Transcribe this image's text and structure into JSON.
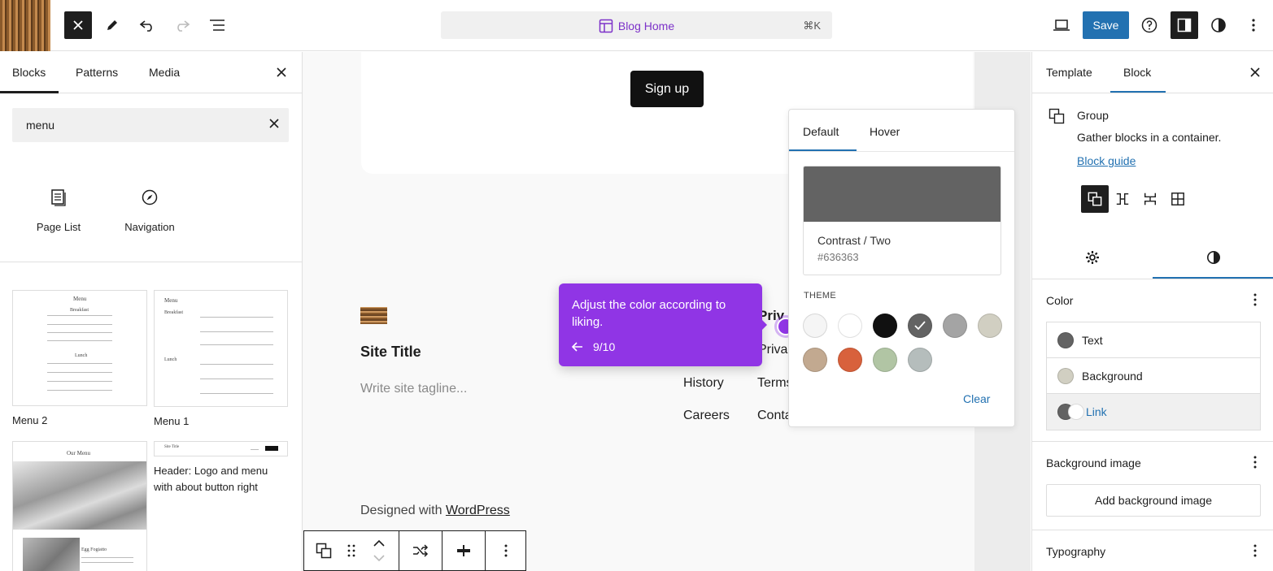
{
  "topbar": {
    "title": "Blog Home",
    "shortcut": "⌘K",
    "save_label": "Save"
  },
  "inserter": {
    "tabs": [
      "Blocks",
      "Patterns",
      "Media"
    ],
    "search_value": "menu",
    "blocks": [
      {
        "label": "Page List",
        "icon": "page-list-icon"
      },
      {
        "label": "Navigation",
        "icon": "compass-icon"
      }
    ],
    "patterns": [
      {
        "label": "Menu 2"
      },
      {
        "label": "Menu 1"
      },
      {
        "label": "Header: Logo and menu with about button right"
      }
    ],
    "mini": {
      "menu": "Menu",
      "breakfast": "Breakfast",
      "lunch": "Lunch",
      "our_menu": "Our Menu",
      "site_title": "Site Title",
      "egg": "Egg Fogiatto"
    }
  },
  "canvas": {
    "signup": "Sign up",
    "site_title": "Site Title",
    "tagline_placeholder": "Write site tagline...",
    "footer_links": [
      "Priv",
      "Privac",
      "History",
      "Terms",
      "Careers",
      "Conta"
    ],
    "designed_prefix": "Designed with ",
    "designed_link": "WordPress"
  },
  "tour": {
    "text": "Adjust the color according to liking.",
    "progress": "9/10"
  },
  "color_popover": {
    "tabs": [
      "Default",
      "Hover"
    ],
    "selected_name": "Contrast / Two",
    "selected_hex": "#636363",
    "section_label": "THEME",
    "swatches": [
      "#f5f5f5",
      "#ffffff",
      "#111111",
      "#636363",
      "#a4a4a4",
      "#d1cfc2",
      "#c2a990",
      "#d8613c",
      "#b1c5a4",
      "#b5bdbc"
    ],
    "selected_index": 3,
    "clear_label": "Clear"
  },
  "settings": {
    "tabs": [
      "Template",
      "Block"
    ],
    "block_title": "Group",
    "block_desc": "Gather blocks in a container.",
    "block_guide": "Block guide",
    "color_section": "Color",
    "color_items": [
      {
        "label": "Text",
        "color": "#636363"
      },
      {
        "label": "Background",
        "color": "#d1cfc2"
      },
      {
        "label": "Link",
        "color": "#636363"
      }
    ],
    "bg_image_section": "Background image",
    "bg_image_button": "Add background image",
    "typography_section": "Typography"
  }
}
